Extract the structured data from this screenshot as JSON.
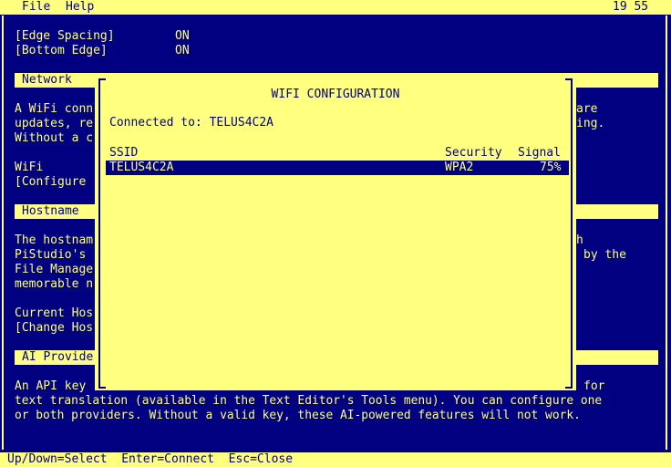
{
  "menubar": {
    "file": "File",
    "help": "Help",
    "clock": "19 55"
  },
  "settings": {
    "edge_spacing_label": "[Edge Spacing]",
    "edge_spacing_value": "ON",
    "bottom_edge_label": "[Bottom Edge]",
    "bottom_edge_value": "ON"
  },
  "network": {
    "title": "Network",
    "line1_left": "A WiFi conn",
    "line1_right": "are",
    "line2_left": "updates, re",
    "line2_right": "ing.",
    "line3_left": "Without a c",
    "wifi_label": "WiFi",
    "configure_button": "[Configure"
  },
  "hostname": {
    "title": "Hostname",
    "line1_left": "The hostnam",
    "line1_right": "h",
    "line2_left": "PiStudio's",
    "line2_right": "by the",
    "line3_left": "File Manage",
    "line4_left": "memorable n",
    "current_label": "Current Hos",
    "change_button": "[Change Hos"
  },
  "ai": {
    "title": "AI Provide",
    "line1_left": "An API key",
    "line1_right": "for",
    "line2": "text translation (available in the Text Editor's Tools menu). You can configure one",
    "line3": "or both providers. Without a valid key, these AI-powered features will not work."
  },
  "dialog": {
    "title": "WIFI CONFIGURATION",
    "connected": "Connected to: TELUS4C2A",
    "columns": {
      "ssid": "SSID",
      "security": "Security",
      "signal": "Signal"
    },
    "networks": [
      {
        "ssid": "TELUS4C2A",
        "security": "WPA2",
        "signal": "75%"
      }
    ]
  },
  "statusbar": {
    "text": "Up/Down=Select  Enter=Connect  Esc=Close"
  }
}
